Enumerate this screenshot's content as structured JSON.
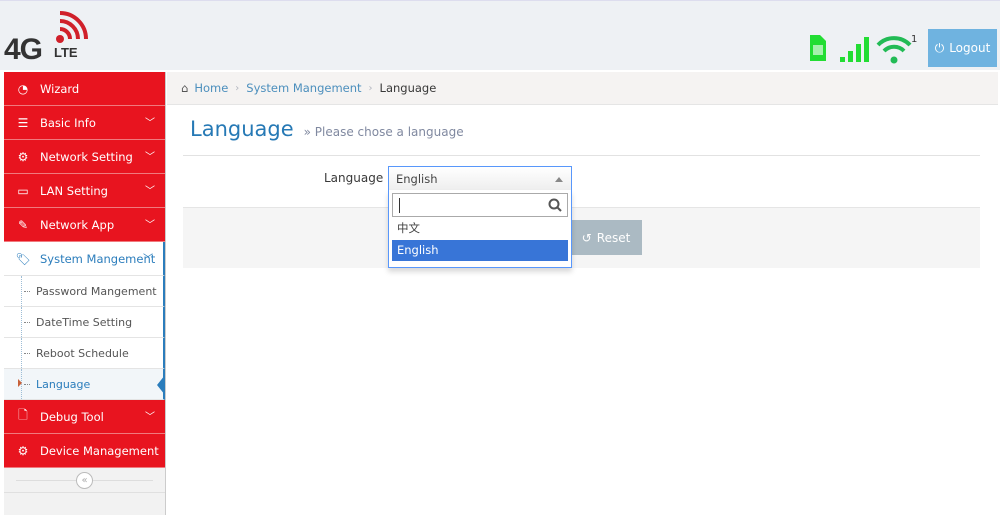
{
  "header": {
    "logo_text": "4G",
    "logo_sub": "LTE",
    "wifi_count": "1",
    "logout_label": "Logout",
    "colors": {
      "status": "#22cc44",
      "logout": "#6fb3e0"
    }
  },
  "sidebar": {
    "items": [
      {
        "label": "Wizard",
        "icon": "dashboard-icon",
        "chevron": false
      },
      {
        "label": "Basic Info",
        "icon": "list-icon",
        "chevron": true
      },
      {
        "label": "Network Setting",
        "icon": "gear-icon",
        "chevron": true
      },
      {
        "label": "LAN Setting",
        "icon": "monitor-icon",
        "chevron": true
      },
      {
        "label": "Network App",
        "icon": "edit-icon",
        "chevron": true
      },
      {
        "label": "System Mangement",
        "icon": "tag-icon",
        "chevron": true,
        "open": true,
        "children": [
          "Password Mangement",
          "DateTime Setting",
          "Reboot Schedule",
          "Language"
        ],
        "active_child": "Language"
      },
      {
        "label": "Debug Tool",
        "icon": "file-icon",
        "chevron": true
      },
      {
        "label": "Device Management",
        "icon": "cogs-icon",
        "chevron": false
      }
    ],
    "collapse_icon": "«",
    "accent": "#e8141f"
  },
  "breadcrumb": {
    "home": "Home",
    "section": "System Mangement",
    "current": "Language"
  },
  "page": {
    "title": "Language",
    "subtitle": "» Please chose a language"
  },
  "form": {
    "label": "Language",
    "selected": "English",
    "search_value": "",
    "options": [
      "中文",
      "English"
    ],
    "reset_label": "Reset"
  }
}
